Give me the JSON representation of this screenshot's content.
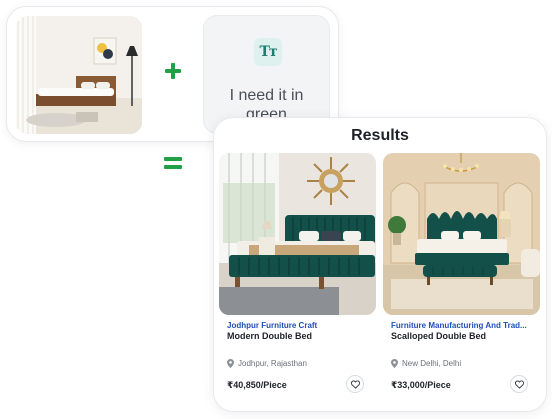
{
  "query": {
    "image_alt": "bedroom photo",
    "text_icon": "text-type-icon",
    "text_icon_glyph": "Tт",
    "text": "I need it in green"
  },
  "operators": {
    "plus": "plus-icon",
    "equals": "equals-icon"
  },
  "results": {
    "title": "Results",
    "products": [
      {
        "supplier": "Jodhpur Furniture Craft",
        "name": "Modern Double Bed",
        "location": "Jodhpur, Rajasthan",
        "price": "₹40,850/Piece"
      },
      {
        "supplier": "Furniture Manufacturing And Trad...",
        "name": "Scalloped Double Bed",
        "location": "New Delhi, Delhi",
        "price": "₹33,000/Piece"
      }
    ]
  },
  "colors": {
    "accent_green": "#22a046",
    "bed_teal": "#14504a",
    "supplier_blue": "#1f4fb4"
  }
}
